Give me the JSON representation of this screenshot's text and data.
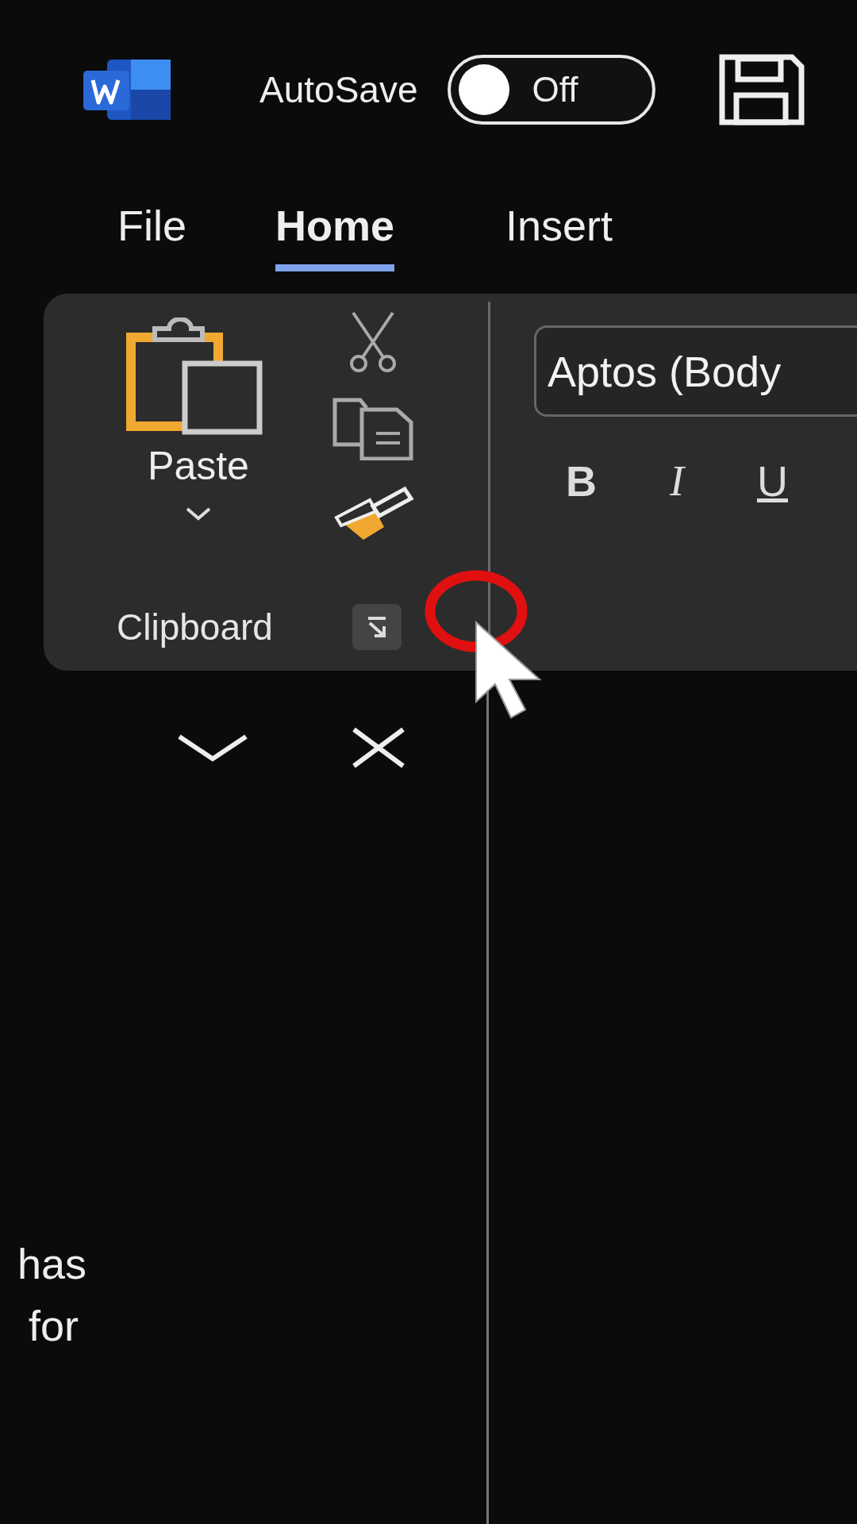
{
  "title_bar": {
    "autosave_label": "AutoSave",
    "autosave": {
      "on": false,
      "label": "Off"
    }
  },
  "tabs": [
    {
      "label": "File",
      "selected": false
    },
    {
      "label": "Home",
      "selected": true
    },
    {
      "label": "Insert",
      "selected": false
    }
  ],
  "clipboard_group": {
    "paste_label": "Paste",
    "group_label": "Clipboard"
  },
  "font_group": {
    "font_name": "Aptos (Body",
    "bold_label": "B",
    "italic_label": "I",
    "underline_label": "U"
  },
  "document_text": [
    "has",
    "for"
  ]
}
